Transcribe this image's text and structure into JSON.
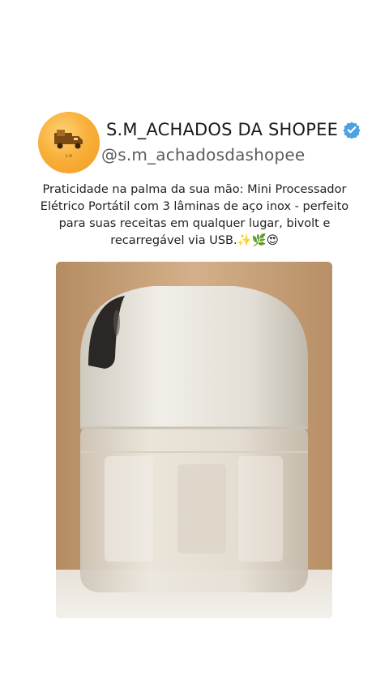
{
  "profile": {
    "name": "S.M_ACHADOS DA SHOPEE",
    "handle": "@s.m_achadosdashopee",
    "avatar_text": "S.M",
    "verified": true,
    "verified_color": "#4aa3df",
    "avatar_color": "#f6a82b"
  },
  "post": {
    "caption": "Praticidade na palma da sua mão: Mini Processador Elétrico Portátil com 3 lâminas de aço inox - perfeito para suas receitas em qualquer lugar, bivolt e recarregável via USB.✨🌿😍"
  },
  "image": {
    "subject": "mini-food-processor",
    "icon": "product-photo"
  }
}
